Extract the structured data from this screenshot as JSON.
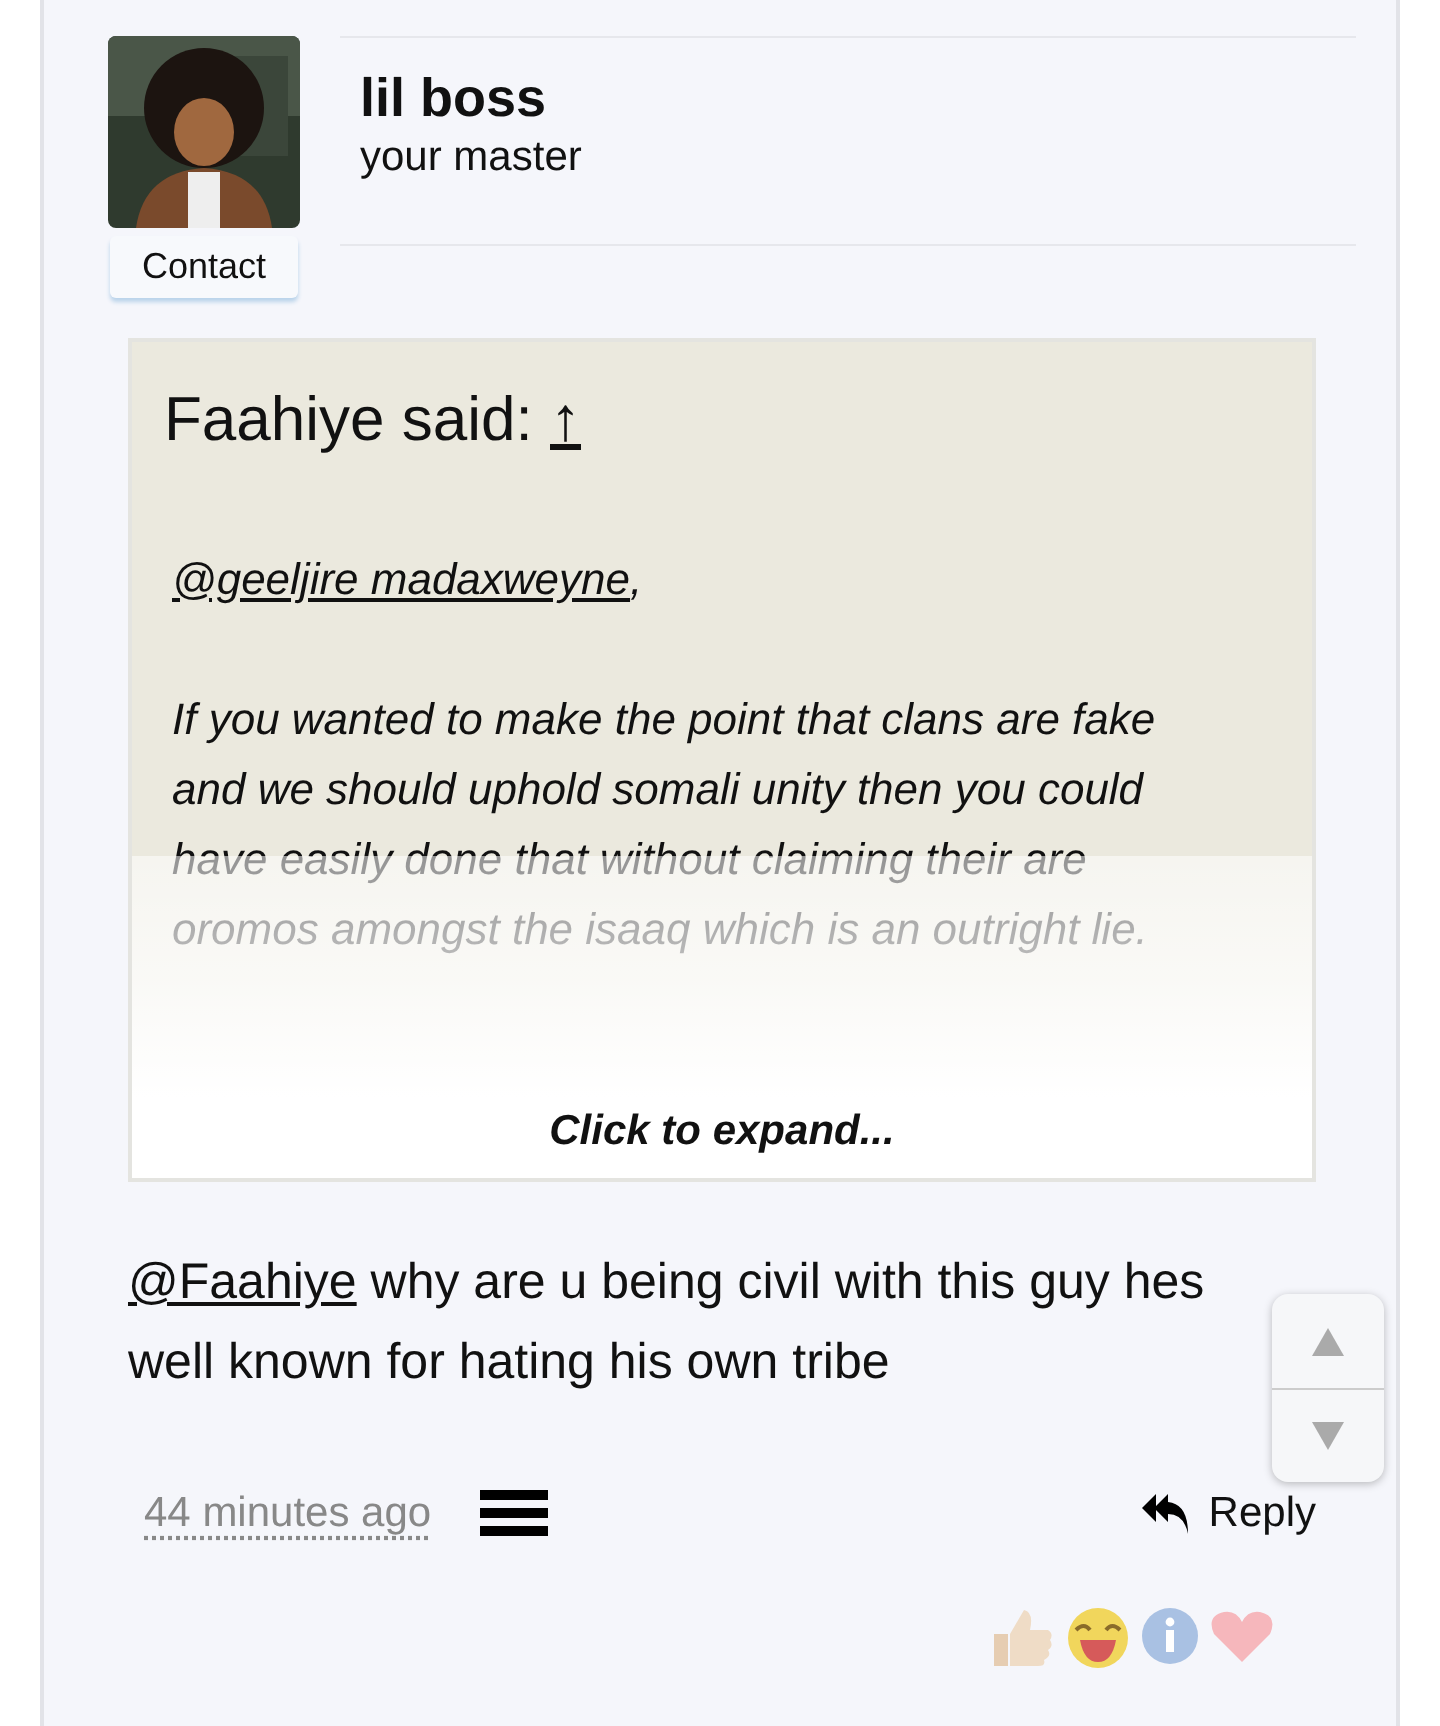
{
  "author": {
    "name": "lil boss",
    "title": "your master",
    "contact_button": "Contact"
  },
  "quote": {
    "author_line": "Faahiye said:",
    "jump_link": "↑",
    "mention": "@geeljire madaxweyne",
    "mention_suffix": ",",
    "text": "If you wanted to make the point that clans are fake and we should uphold somali unity then you could have easily done that without claiming their are oromos amongst the isaaq which is an outright lie.",
    "expand": "Click to expand...",
    "collapsed": true
  },
  "message": {
    "mention": "@Faahiye",
    "text": " why are u being civil with this guy hes well known for hating his own tribe"
  },
  "footer": {
    "time": "44 minutes ago",
    "reply": "Reply"
  },
  "scroll_buttons": [
    {
      "kind": "up"
    },
    {
      "kind": "down"
    }
  ]
}
